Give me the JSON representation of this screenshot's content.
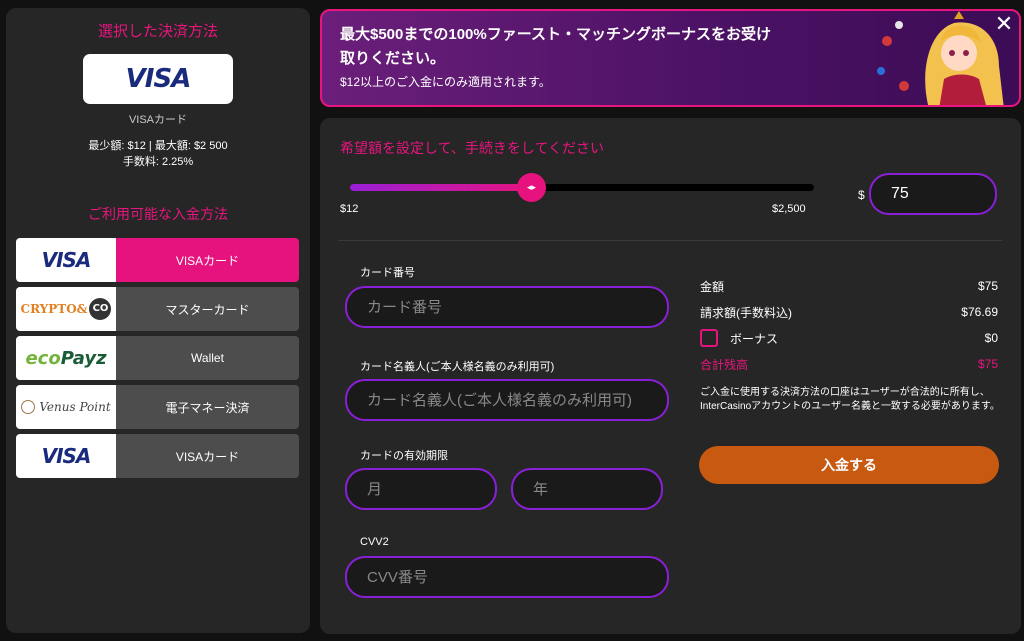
{
  "left": {
    "title": "選択した決済方法",
    "selected_logo": "VISA",
    "selected_label": "VISAカード",
    "limits": "最少額: $12 | 最大額: $2 500",
    "fee": "手数料: 2.25%",
    "available_title": "ご利用可能な入金方法",
    "methods": [
      {
        "logo": "VISA",
        "logo_icon": "visa-logo",
        "label": "VISAカード",
        "active": true
      },
      {
        "logo": "CRYPTO&CO",
        "logo_icon": "cryptoco-logo",
        "label": "マスターカード",
        "active": false
      },
      {
        "logo": "ecoPayz",
        "logo_icon": "ecopayz-logo",
        "label": "Wallet",
        "active": false
      },
      {
        "logo": "Venus Point",
        "logo_icon": "venuspoint-logo",
        "label": "電子マネー決済",
        "active": false
      },
      {
        "logo": "VISA",
        "logo_icon": "visa-logo",
        "label": "VISAカード",
        "active": false
      }
    ]
  },
  "banner": {
    "line1": "最大$500までの100%ファースト・マッチングボーナスをお受け取りください。",
    "line2": "$12以上のご入金にのみ適用されます。",
    "close": "✕"
  },
  "main": {
    "prompt": "希望額を設定して、手続きをしてください",
    "slider": {
      "min_label": "$12",
      "max_label": "$2,500",
      "min": 12,
      "max": 2500,
      "value": 75,
      "thumb": "◂▸"
    },
    "currency": "$",
    "amount": "75",
    "form": {
      "card_number_label": "カード番号",
      "card_number_placeholder": "カード番号",
      "holder_label": "カード名義人(ご本人様名義のみ利用可)",
      "holder_placeholder": "カード名義人(ご本人様名義のみ利用可)",
      "expiry_label": "カードの有効期限",
      "month_placeholder": "月",
      "year_placeholder": "年",
      "cvv_label": "CVV2",
      "cvv_placeholder": "CVV番号"
    },
    "summary": {
      "amount_label": "金額",
      "amount_value": "$75",
      "billed_label": "請求額(手数料込)",
      "billed_value": "$76.69",
      "bonus_label": "ボーナス",
      "bonus_value": "$0",
      "total_label": "合計残高",
      "total_value": "$75"
    },
    "notice": "ご入金に使用する決済方法の口座はユーザーが合法的に所有し、InterCasinoアカウントのユーザー名義と一致する必要があります。",
    "deposit_button": "入金する"
  },
  "colors": {
    "accent": "#e6137e",
    "purple": "#8a1fd8",
    "button": "#c75a10",
    "panel": "#262626"
  }
}
